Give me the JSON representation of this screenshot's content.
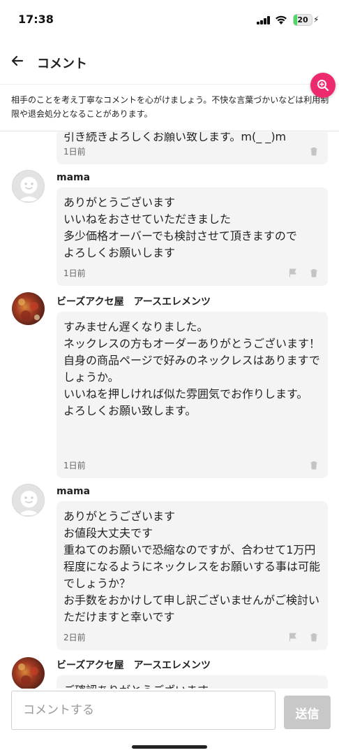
{
  "status": {
    "time": "17:38",
    "battery": "20",
    "battery_level": 0.2
  },
  "header": {
    "title": "コメント"
  },
  "notice": {
    "text": "相手のことを考え丁寧なコメントを心がけましょう。不快な言葉づかいなどは利用制限や退会処分となることがあります。"
  },
  "comments": [
    {
      "author": "",
      "body": "引き続きよろしくお願い致します。m(_ _)m",
      "time": "1日前",
      "avatar": "shop"
    },
    {
      "author": "mama",
      "body": "ありがとうございます\nいいねをおさせていただきました\n多少価格オーバーでも検討させて頂きますので\nよろしくお願いします",
      "time": "1日前",
      "avatar": "default"
    },
    {
      "author": "ビーズアクセ屋　アースエレメンツ",
      "body": "すみません遅くなりました。\nネックレスの方もオーダーありがとうございます！\n自身の商品ページで好みのネックレスはありますでしょうか。\nいいねを押しければ似た雰囲気でお作りします。\nよろしくお願い致します。",
      "time": "1日前",
      "avatar": "shop"
    },
    {
      "author": "mama",
      "body": "ありがとうございます\nお値段大丈夫です\n重ねてのお願いで恐縮なのですが、合わせて1万円程度になるようにネックレスをお願いする事は可能でしょうか？\nお手数をおかけして申し訳ございませんがご検討いただけますと幸いです",
      "time": "2日前",
      "avatar": "default"
    },
    {
      "author": "ビーズアクセ屋　アースエレメンツ",
      "body": "ご確認ありがとうございます",
      "time": "",
      "avatar": "shop"
    }
  ],
  "input": {
    "placeholder": "コメントする",
    "value": ""
  },
  "send_button": {
    "label": "送信"
  },
  "colors": {
    "accent": "#ee2a6e",
    "bubble": "#f4f4f4",
    "send_disabled": "#c8c8c8"
  }
}
